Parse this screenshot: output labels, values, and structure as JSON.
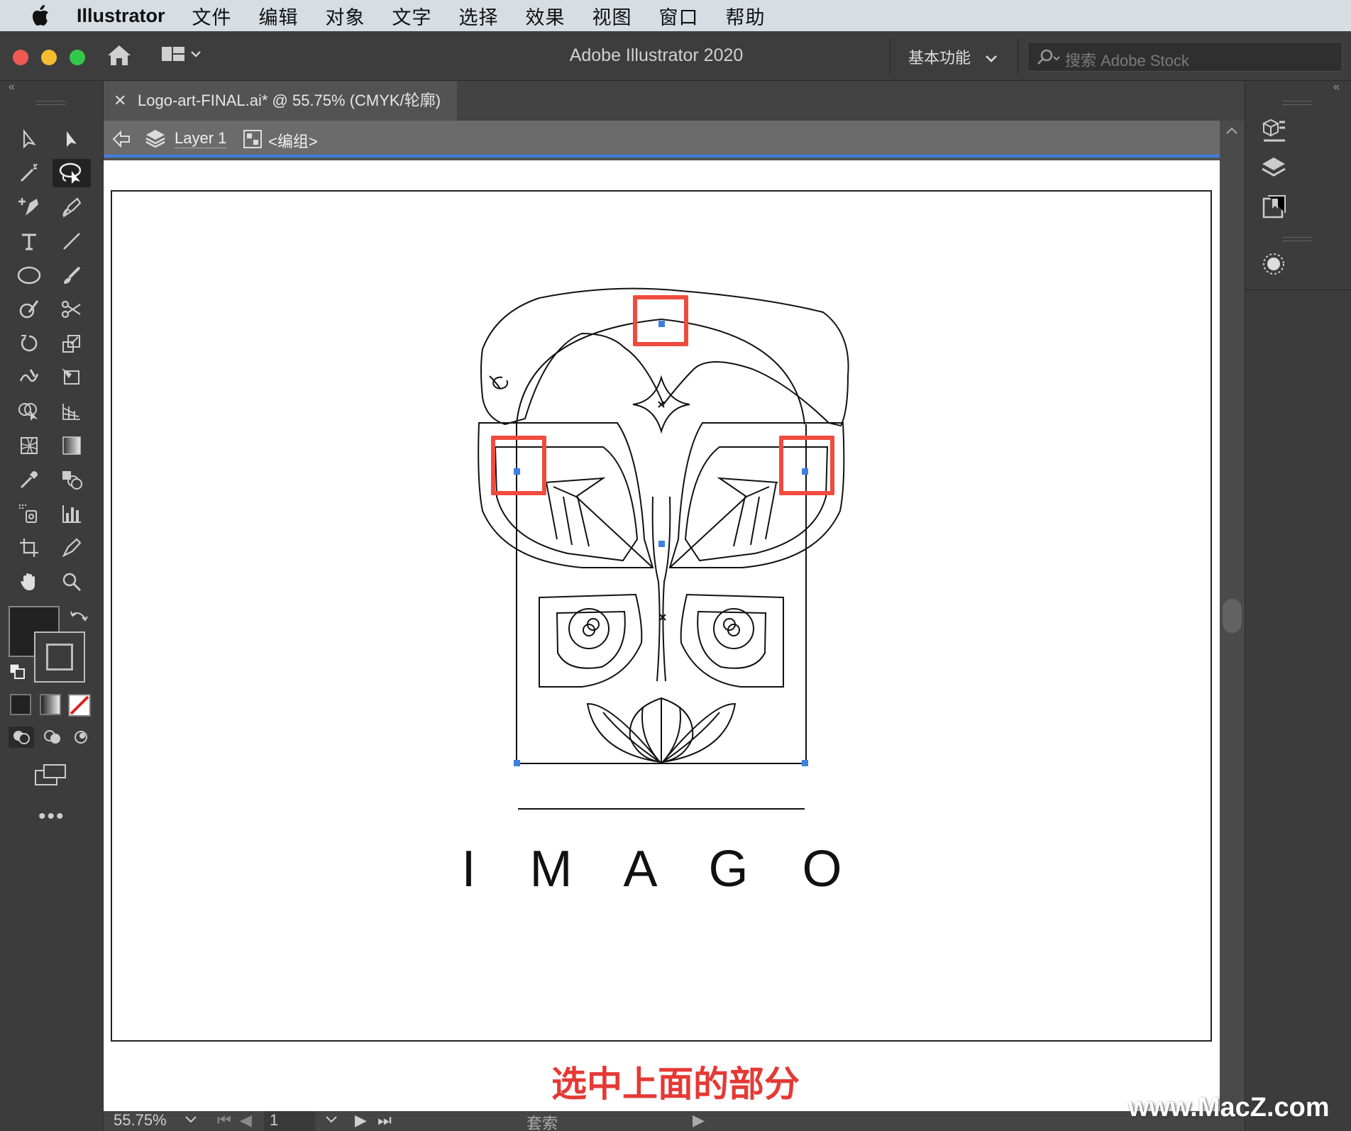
{
  "menubar": {
    "app_name": "Illustrator",
    "items": [
      "文件",
      "编辑",
      "对象",
      "文字",
      "选择",
      "效果",
      "视图",
      "窗口",
      "帮助"
    ]
  },
  "titlebar": {
    "title": "Adobe Illustrator 2020",
    "workspace": "基本功能",
    "search_placeholder": "搜索 Adobe Stock"
  },
  "document": {
    "tab_title": "Logo-art-FINAL.ai* @ 55.75% (CMYK/轮廓)",
    "breadcrumb_layer": "Layer 1",
    "breadcrumb_group": "<编组>"
  },
  "artwork": {
    "logo_text": "I M A G O"
  },
  "statusbar": {
    "zoom": "55.75%",
    "artboard_number": "1",
    "tool_name": "套索"
  },
  "overlay": {
    "caption": "选中上面的部分",
    "watermark": "www.MacZ.com"
  },
  "colors": {
    "highlight": "#ef4b3e",
    "selection_anchor": "#3e7fe0",
    "canvas_bg": "#ffffff",
    "ui_dark": "#3c3c3c"
  }
}
